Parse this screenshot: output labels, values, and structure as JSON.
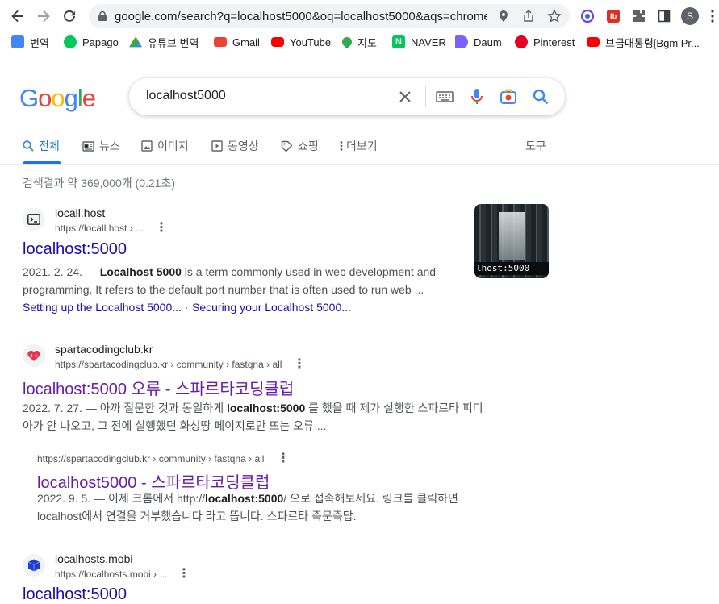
{
  "browser": {
    "url": "google.com/search?q=localhost5000&oq=localhost5000&aqs=chrome...",
    "profile_initial": "S"
  },
  "bookmarks": [
    {
      "label": "번역",
      "icon": "google-translate-icon",
      "color": "#4285f4"
    },
    {
      "label": "Papago",
      "icon": "papago-icon",
      "color": "#03c75a"
    },
    {
      "label": "유튜브 번역",
      "icon": "google-drive-icon",
      "color": "#fbbc04"
    },
    {
      "label": "Gmail",
      "icon": "gmail-icon",
      "color": "#ea4335"
    },
    {
      "label": "YouTube",
      "icon": "youtube-icon",
      "color": "#ff0000"
    },
    {
      "label": "지도",
      "icon": "maps-icon",
      "color": "#34a853"
    },
    {
      "label": "NAVER",
      "icon": "naver-icon",
      "color": "#03c75a"
    },
    {
      "label": "Daum",
      "icon": "daum-icon",
      "color": "#7b61ff"
    },
    {
      "label": "Pinterest",
      "icon": "pinterest-icon",
      "color": "#e60023"
    },
    {
      "label": "브금대통령[Bgm Pr...",
      "icon": "youtube-icon",
      "color": "#ff0000"
    }
  ],
  "search": {
    "logo": "Google",
    "query": "localhost5000"
  },
  "tabs": [
    {
      "label": "전체",
      "icon": "search-icon"
    },
    {
      "label": "뉴스",
      "icon": "news-icon"
    },
    {
      "label": "이미지",
      "icon": "image-icon"
    },
    {
      "label": "동영상",
      "icon": "video-icon"
    },
    {
      "label": "쇼핑",
      "icon": "tag-icon"
    },
    {
      "label": "더보기",
      "icon": "more-vert-icon"
    },
    {
      "label": "도구",
      "icon": ""
    }
  ],
  "stats": "검색결과 약 369,000개 (0.21초)",
  "results": [
    {
      "site": "locall.host",
      "url": "https://locall.host › ...",
      "title": "localhost:5000",
      "snippet_line1_pre": "2021. 2. 24. — ",
      "snippet_line1_bold": "Localhost 5000",
      "snippet_line1_post": " is a term commonly used in web development and",
      "snippet_line2": "programming. It refers to the default port number that is often used to run web ...",
      "sitelink1": "Setting up the Localhost 5000...",
      "sitelink_sep": "·",
      "sitelink2": "Securing your Localhost 5000...",
      "thumb_text": "lhost:5000"
    },
    {
      "site": "spartacodingclub.kr",
      "url": "https://spartacodingclub.kr › community › fastqna › all",
      "title": "localhost:5000 오류 - 스파르타코딩클럽",
      "snippet_line1_pre": "2022. 7. 27. — 아까 질문한 것과 동일하게 ",
      "snippet_line1_bold": "localhost:5000",
      "snippet_line1_post": " 를 했을 때 제가 실행한 스파르타 피디",
      "snippet_line2": "아가 안 나오고, 그 전에 실행했던 화성땅 페이지로만 뜨는 오류 ..."
    },
    {
      "url": "https://spartacodingclub.kr › community › fastqna › all",
      "title": "localhost5000 - 스파르타코딩클럽",
      "snippet_line1_pre": "2022. 9. 5. — 이제 크롬에서 http://",
      "snippet_line1_bold": "localhost:5000",
      "snippet_line1_post": "/ 으로 접속해보세요. 링크를 클릭하면",
      "snippet_line2": "localhost에서 연결을 거부했습니다 라고 뜹니다. 스파르타 즉문즉답."
    },
    {
      "site": "localhosts.mobi",
      "url": "https://localhosts.mobi › ...",
      "title": "localhost:5000"
    }
  ]
}
